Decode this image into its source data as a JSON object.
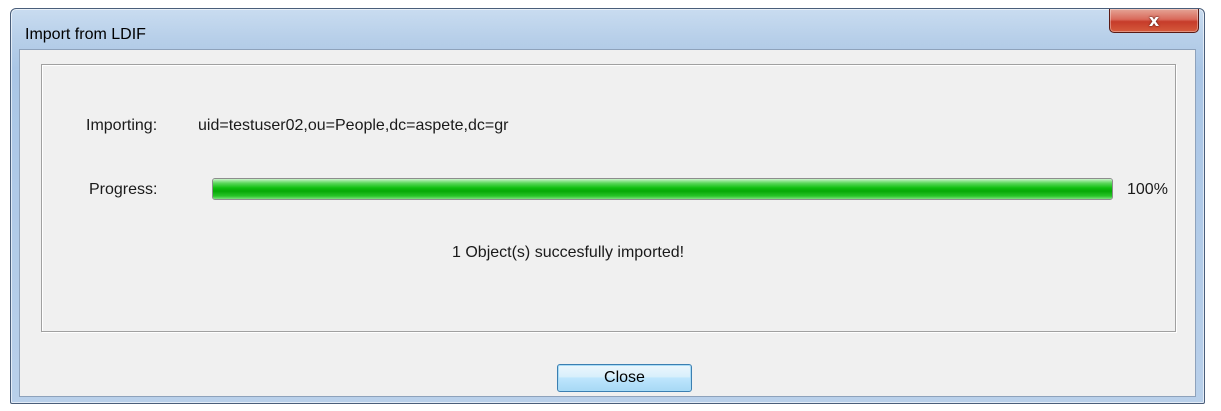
{
  "window": {
    "title": "Import from LDIF",
    "close_glyph": "x"
  },
  "import": {
    "importing_label": "Importing:",
    "importing_value": "uid=testuser02,ou=People,dc=aspete,dc=gr",
    "progress_label": "Progress:",
    "progress_percent": 100,
    "progress_text": "100%",
    "status_message": "1 Object(s) succesfully imported!"
  },
  "buttons": {
    "close_label": "Close"
  },
  "icons": {
    "title_close": "close-icon"
  },
  "colors": {
    "progress_green": "#06a806",
    "title_close_red": "#c63c2a",
    "dialog_face": "#f0f0f0",
    "title_blue": "#b7cfe9"
  }
}
